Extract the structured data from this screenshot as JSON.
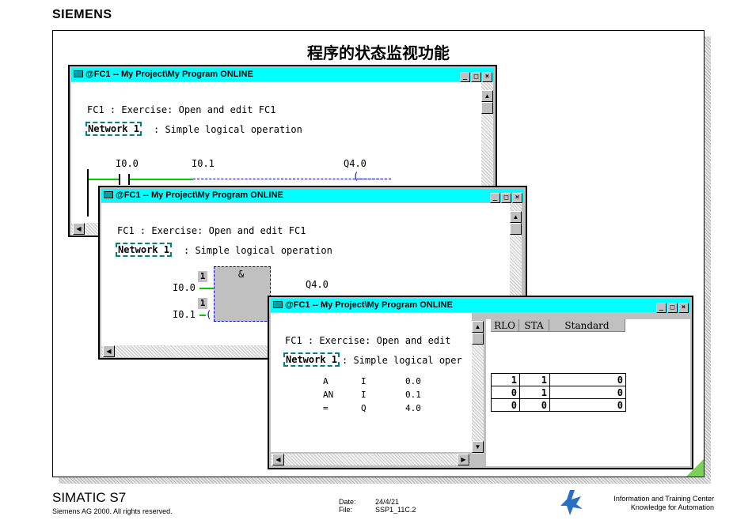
{
  "brand": "SIEMENS",
  "slide_title": "程序的状态监视功能",
  "window_title": "@FC1 -- My Project\\My Program  ONLINE",
  "window_buttons": {
    "minimize": "_",
    "maximize": "□",
    "close": "×"
  },
  "header_line": "FC1 : Exercise: Open and edit FC1",
  "header_line_cut": "FC1 : Exercise: Open and edit",
  "network_label": "Network 1",
  "network_desc": ": Simple logical operation",
  "network_desc_cut": ": Simple logical oper",
  "lad": {
    "contact1": "I0.0",
    "contact2": "I0.1",
    "coil": "Q4.0"
  },
  "fbd": {
    "box_symbol": "&",
    "input_flag": "1",
    "input1": "I0.0",
    "input2": "I0.1",
    "output": "Q4.0"
  },
  "stl": {
    "columns": [
      "RLO",
      "STA",
      "Standard"
    ],
    "rows": [
      {
        "op": "A",
        "area": "I",
        "addr": "0.0",
        "rlo": "1",
        "sta": "1",
        "std": "0"
      },
      {
        "op": "AN",
        "area": "I",
        "addr": "0.1",
        "rlo": "0",
        "sta": "1",
        "std": "0"
      },
      {
        "op": "=",
        "area": "Q",
        "addr": "4.0",
        "rlo": "0",
        "sta": "0",
        "std": "0"
      }
    ]
  },
  "footer": {
    "product": "SIMATIC S7",
    "copyright": "Siemens AG 2000. All rights reserved.",
    "date_label": "Date:",
    "date_value": "24/4/21",
    "file_label": "File:",
    "file_value": "SSP1_11C.2",
    "center_line1": "Information and Training Center",
    "center_line2": "Knowledge for Automation"
  }
}
